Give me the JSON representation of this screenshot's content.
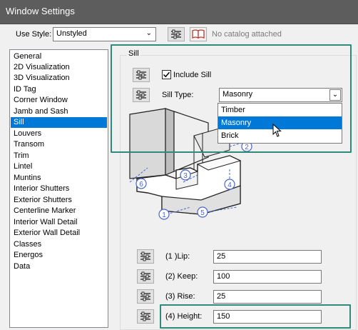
{
  "window": {
    "title": "Window Settings"
  },
  "style_row": {
    "label": "Use Style:",
    "value": "Unstyled",
    "catalog_text": "No catalog attached"
  },
  "nav": {
    "items": [
      "General",
      "2D Visualization",
      "3D Visualization",
      "ID Tag",
      "Corner Window",
      "Jamb and Sash",
      "Sill",
      "Louvers",
      "Transom",
      "Trim",
      "Lintel",
      "Muntins",
      "Interior Shutters",
      "Exterior Shutters",
      "Centerline Marker",
      "Interior Wall Detail",
      "Exterior Wall Detail",
      "Classes",
      "Energos",
      "Data"
    ],
    "selected_index": 6
  },
  "sill": {
    "group_title": "Sill",
    "include_label": "Include Sill",
    "include_checked": true,
    "type_label": "Sill Type:",
    "type_value": "Masonry",
    "type_options": [
      "Timber",
      "Masonry",
      "Brick"
    ],
    "highlighted_option": "Masonry"
  },
  "diagram": {
    "callouts": [
      "1",
      "2",
      "3",
      "4",
      "5",
      "6"
    ]
  },
  "params": [
    {
      "label": "(1 )Lip:",
      "value": "25"
    },
    {
      "label": "(2) Keep:",
      "value": "100"
    },
    {
      "label": "(3) Rise:",
      "value": "25"
    },
    {
      "label": "(4) Height:",
      "value": "150"
    }
  ],
  "colors": {
    "titlebar": "#5d5d5d",
    "selection": "#0078d7",
    "highlight_box": "#2e8b7a",
    "callout": "#4a66c8"
  }
}
